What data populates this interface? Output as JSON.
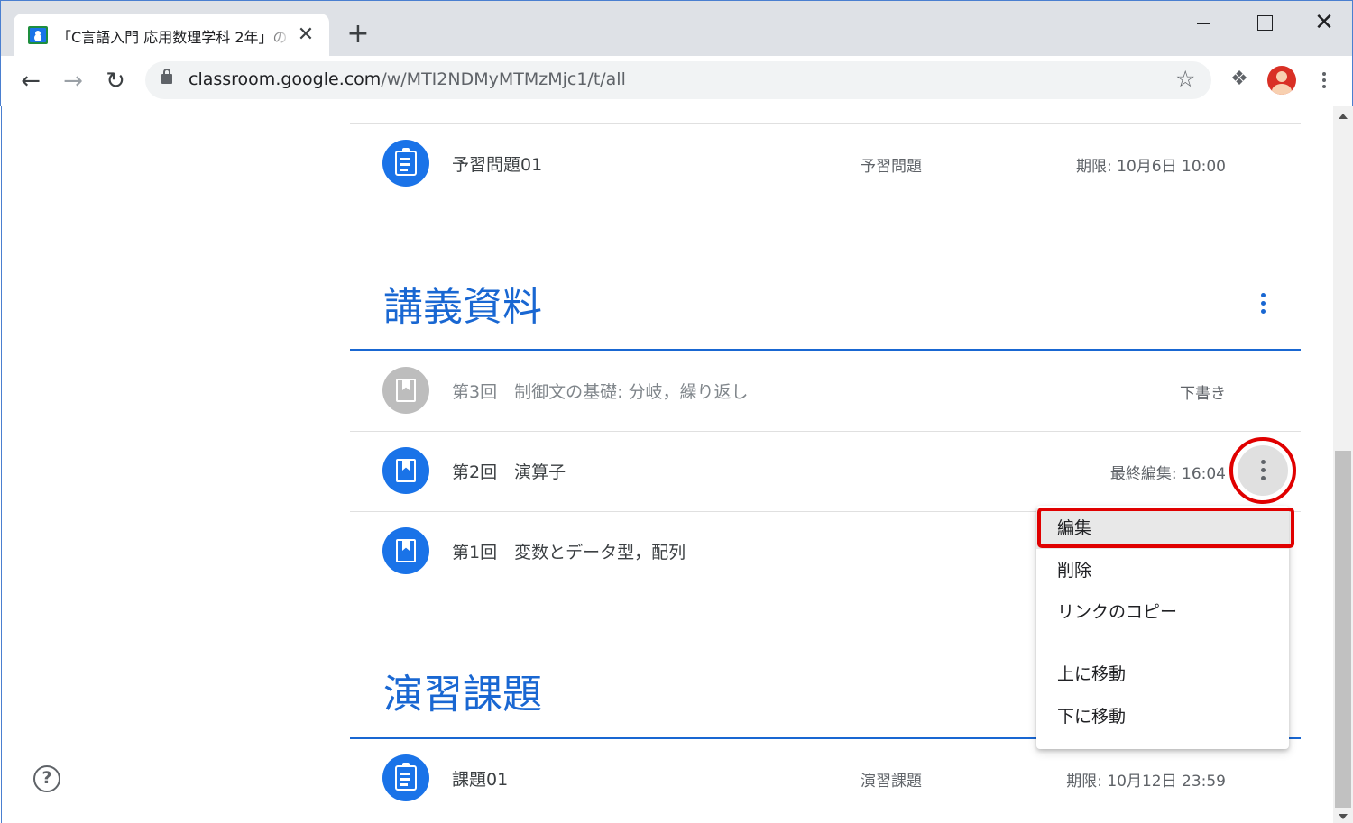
{
  "browser": {
    "tab_title": "「C言語入門 応用数理学科 2年」の",
    "tab_close": "✕",
    "new_tab": "+",
    "url_host": "classroom.google.com",
    "url_path": "/w/MTI2NDMyMTMzMjc1/t/all",
    "window_close": "✕"
  },
  "stream": {
    "prev_item": {
      "title": "予習問題01",
      "topic": "予習問題",
      "meta": "期限: 10月6日 10:00"
    },
    "sections": [
      {
        "title": "講義資料",
        "items": [
          {
            "title": "第3回　制御文の基礎: 分岐，繰り返し",
            "meta": "下書き",
            "state": "draft"
          },
          {
            "title": "第2回　演算子",
            "meta": "最終編集: 16:04",
            "state": "published"
          },
          {
            "title": "第1回　変数とデータ型，配列",
            "meta": "",
            "state": "published"
          }
        ]
      },
      {
        "title": "演習課題",
        "items": [
          {
            "title": "課題01",
            "topic": "演習課題",
            "meta": "期限: 10月12日 23:59"
          }
        ]
      }
    ]
  },
  "context_menu": {
    "items": [
      "編集",
      "削除",
      "リンクのコピー",
      "上に移動",
      "下に移動"
    ],
    "highlighted": "編集"
  },
  "help": "?",
  "colors": {
    "accent": "#1967d2",
    "annotation": "#e00000",
    "draft": "#bdbdbd"
  }
}
